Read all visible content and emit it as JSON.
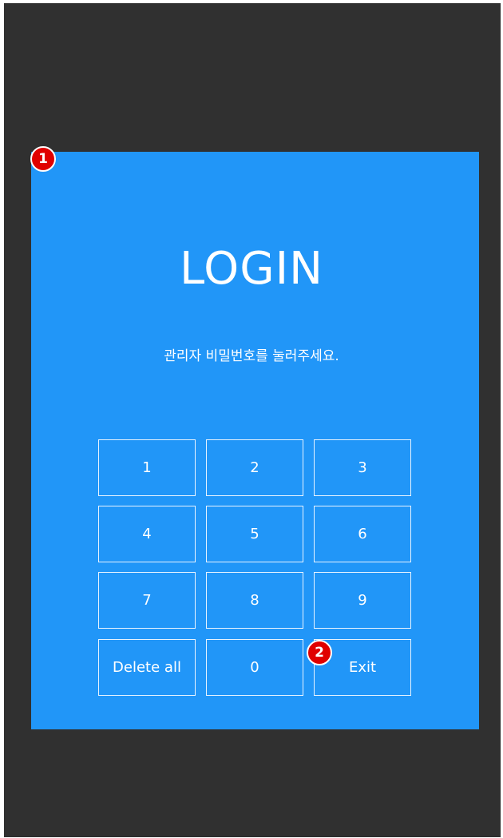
{
  "login": {
    "title": "LOGIN",
    "subtitle": "관리자 비밀번호를 눌러주세요."
  },
  "keypad": {
    "keys": [
      "1",
      "2",
      "3",
      "4",
      "5",
      "6",
      "7",
      "8",
      "9",
      "Delete all",
      "0",
      "Exit"
    ]
  },
  "annotations": {
    "badge1": "1",
    "badge2": "2"
  },
  "colors": {
    "background": "#303030",
    "panel": "#2196f8",
    "badge": "#e00000"
  }
}
